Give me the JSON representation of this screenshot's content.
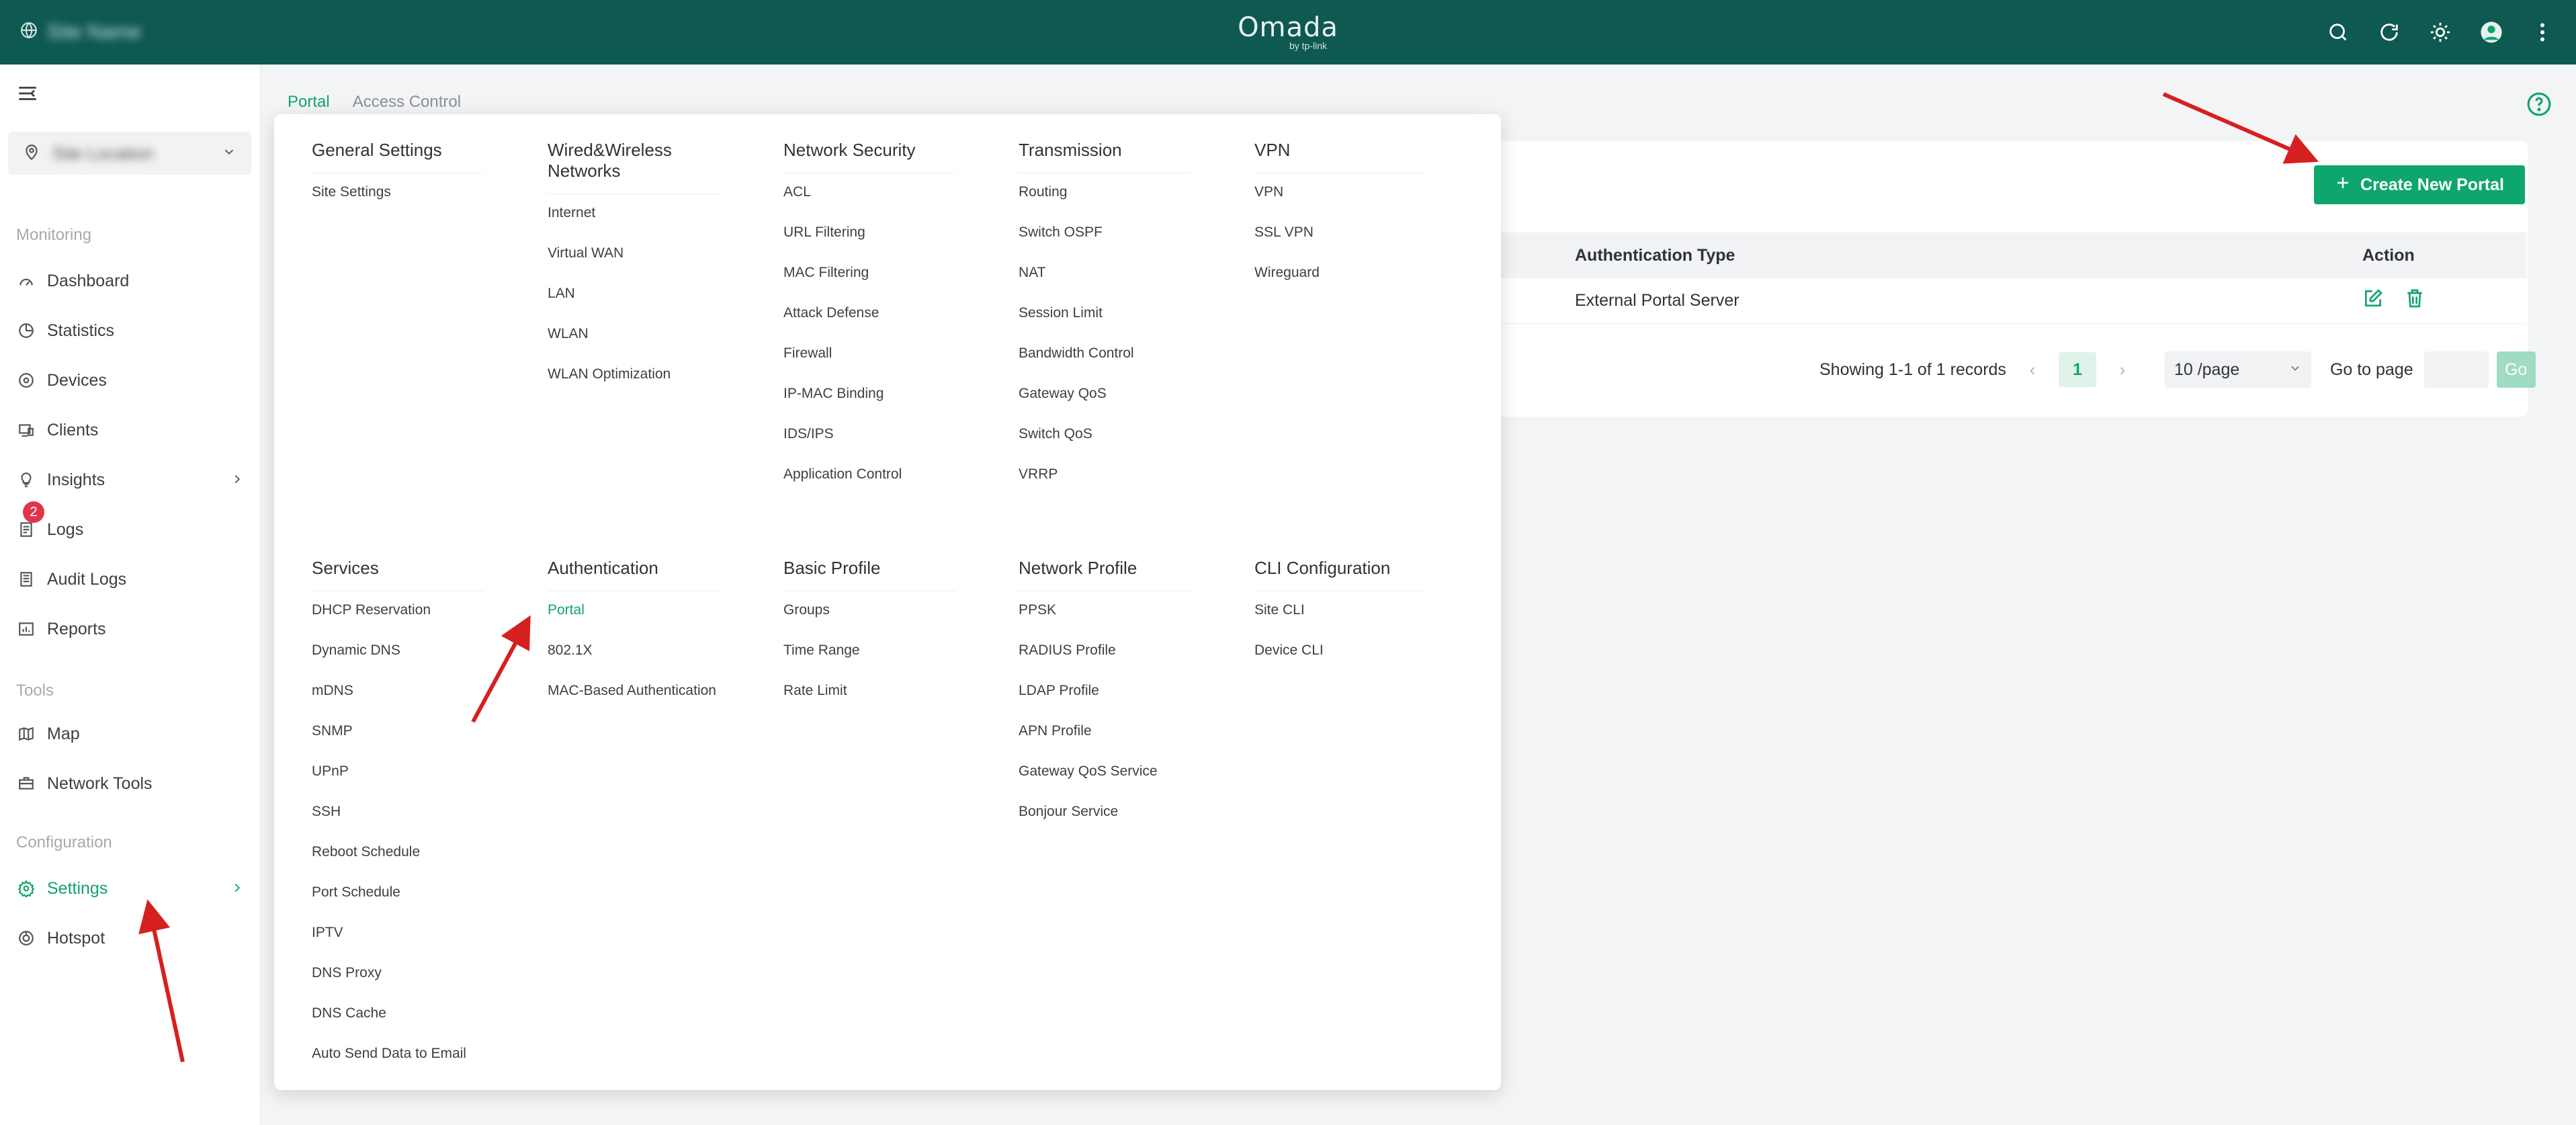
{
  "topbar": {
    "site_name": "Site Name",
    "logo": "Omada",
    "logo_sub": "by tp-link"
  },
  "sidebar": {
    "site_selector": "Site Location",
    "sections": {
      "monitoring": "Monitoring",
      "tools": "Tools",
      "configuration": "Configuration"
    },
    "items": {
      "dashboard": "Dashboard",
      "statistics": "Statistics",
      "devices": "Devices",
      "clients": "Clients",
      "insights": "Insights",
      "logs": "Logs",
      "logs_badge": "2",
      "audit_logs": "Audit Logs",
      "reports": "Reports",
      "map": "Map",
      "network_tools": "Network Tools",
      "settings": "Settings",
      "hotspot": "Hotspot"
    }
  },
  "tabs": [
    "Portal",
    "Access Control"
  ],
  "toolbar": {
    "create_label": "Create New Portal"
  },
  "table": {
    "headers": {
      "auth_type": "Authentication Type",
      "action": "Action"
    },
    "rows": [
      {
        "auth_type": "External Portal Server"
      }
    ]
  },
  "pagination": {
    "summary": "Showing 1-1 of 1 records",
    "current_page": "1",
    "page_size": "10 /page",
    "goto_label": "Go to page",
    "go_button": "Go"
  },
  "menu": {
    "columns": [
      {
        "title": "General Settings",
        "items": [
          "Site Settings"
        ]
      },
      {
        "title": "Wired&Wireless Networks",
        "items": [
          "Internet",
          "Virtual WAN",
          "LAN",
          "WLAN",
          "WLAN Optimization"
        ]
      },
      {
        "title": "Network Security",
        "items": [
          "ACL",
          "URL Filtering",
          "MAC Filtering",
          "Attack Defense",
          "Firewall",
          "IP-MAC Binding",
          "IDS/IPS",
          "Application Control"
        ]
      },
      {
        "title": "Transmission",
        "items": [
          "Routing",
          "Switch OSPF",
          "NAT",
          "Session Limit",
          "Bandwidth Control",
          "Gateway QoS",
          "Switch QoS",
          "VRRP"
        ]
      },
      {
        "title": "VPN",
        "items": [
          "VPN",
          "SSL VPN",
          "Wireguard"
        ]
      },
      {
        "title": "Services",
        "items": [
          "DHCP Reservation",
          "Dynamic DNS",
          "mDNS",
          "SNMP",
          "UPnP",
          "SSH",
          "Reboot Schedule",
          "Port Schedule",
          "IPTV",
          "DNS Proxy",
          "DNS Cache",
          "Auto Send Data to Email"
        ]
      },
      {
        "title": "Authentication",
        "items": [
          "Portal",
          "802.1X",
          "MAC-Based Authentication"
        ]
      },
      {
        "title": "Basic Profile",
        "items": [
          "Groups",
          "Time Range",
          "Rate Limit"
        ]
      },
      {
        "title": "Network Profile",
        "items": [
          "PPSK",
          "RADIUS Profile",
          "LDAP Profile",
          "APN Profile",
          "Gateway QoS Service",
          "Bonjour Service"
        ]
      },
      {
        "title": "CLI Configuration",
        "items": [
          "Site CLI",
          "Device CLI"
        ]
      }
    ],
    "active_item": "Portal"
  },
  "colors": {
    "topbar": "#0e5952",
    "accent": "#13a36b",
    "badge": "#e0344d",
    "arrow": "#d6201f"
  }
}
